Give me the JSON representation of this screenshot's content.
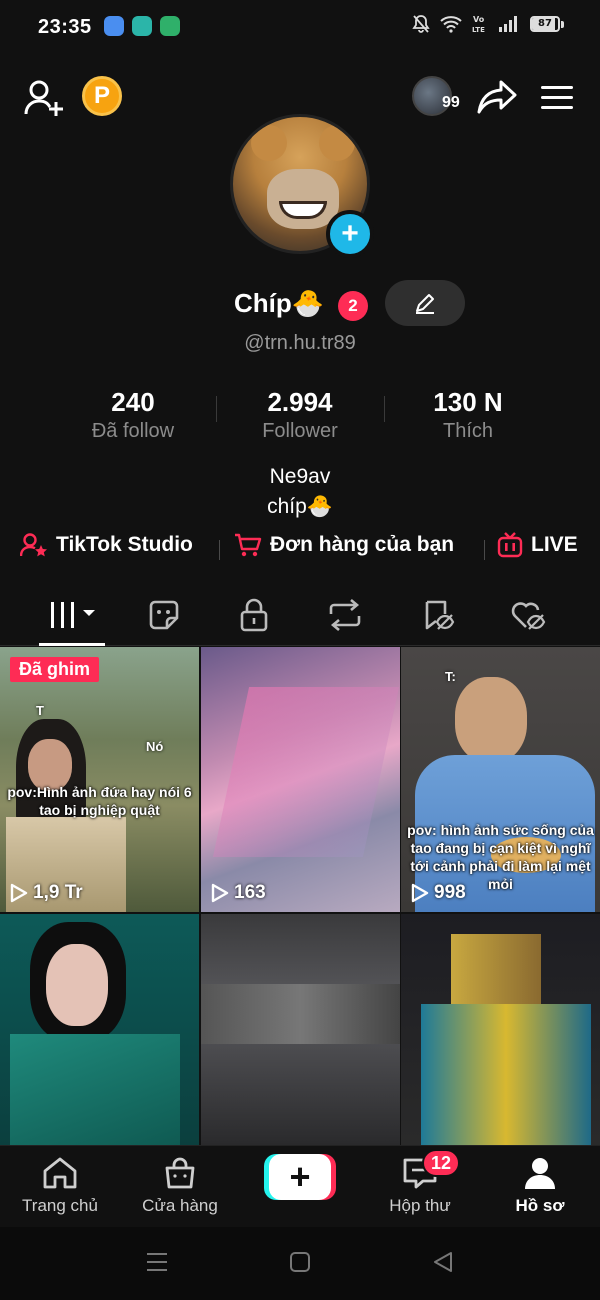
{
  "status_bar": {
    "time": "23:35",
    "battery": "87",
    "network": "Vo LTE"
  },
  "colors": {
    "accent": "#fe2c55",
    "cyan": "#25f4ee",
    "plus_blue": "#1fb8e8",
    "coin": "#f7a310",
    "background": "#111111"
  },
  "top_bar": {
    "follower_count_badge": "99",
    "coin_letter": "P"
  },
  "profile": {
    "display_name": "Chíp🐣",
    "notification_count": "2",
    "username": "@trn.hu.tr89",
    "stats": [
      {
        "value": "240",
        "label": "Đã follow"
      },
      {
        "value": "2.994",
        "label": "Follower"
      },
      {
        "value": "130 N",
        "label": "Thích"
      }
    ],
    "bio_lines": [
      "Ne9av",
      "chíp🐣"
    ]
  },
  "quick_links": [
    {
      "label": "TikTok Studio",
      "icon": "person-star-icon"
    },
    {
      "label": "Đơn hàng của bạn",
      "icon": "cart-icon"
    },
    {
      "label": "LIVE",
      "icon": "tv-icon"
    }
  ],
  "tabs": [
    {
      "name": "videos",
      "icon": "grid-bars-icon",
      "active": true
    },
    {
      "name": "stickers",
      "icon": "sticker-icon"
    },
    {
      "name": "private",
      "icon": "lock-icon"
    },
    {
      "name": "reposts",
      "icon": "repost-icon"
    },
    {
      "name": "favorites",
      "icon": "bookmark-hidden-icon"
    },
    {
      "name": "liked",
      "icon": "heart-hidden-icon"
    }
  ],
  "videos": [
    {
      "pinned_label": "Đã ghim",
      "caption": "pov:Hình ảnh đứa hay nói 6 tao bị nghiệp quật",
      "small_texts": [
        "T",
        "Nó"
      ],
      "views": "1,9 Tr"
    },
    {
      "caption": "",
      "views": "163"
    },
    {
      "caption": "pov: hình ảnh sức sống của tao đang bị cạn kiệt vì nghĩ tới cảnh phải đi làm lại mệt mỏi",
      "small_texts": [
        "T:"
      ],
      "views": "998"
    },
    {
      "caption": "",
      "views": ""
    },
    {
      "caption": "",
      "views": ""
    },
    {
      "caption": "",
      "views": ""
    }
  ],
  "bottom_nav": {
    "items": [
      {
        "label": "Trang chủ",
        "icon": "home-icon"
      },
      {
        "label": "Cửa hàng",
        "icon": "shopping-bag-icon"
      },
      {
        "label": "+",
        "icon": "create-icon"
      },
      {
        "label": "Hộp thư",
        "icon": "inbox-icon"
      },
      {
        "label": "Hồ sơ",
        "icon": "profile-icon",
        "active": true
      }
    ],
    "inbox_badge": "12"
  }
}
